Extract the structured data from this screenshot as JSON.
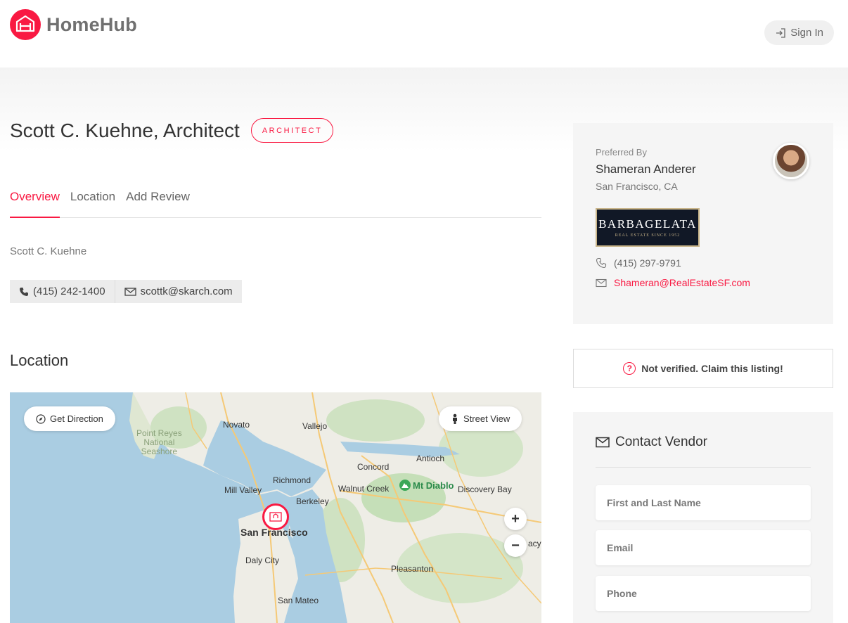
{
  "header": {
    "brand": "HomeHub",
    "sign_in": "Sign In"
  },
  "listing": {
    "title": "Scott C. Kuehne, Architect",
    "category_tag": "ARCHITECT",
    "tabs": [
      "Overview",
      "Location",
      "Add Review"
    ],
    "active_tab": "Overview",
    "owner": "Scott C. Kuehne",
    "phone": "(415) 242-1400",
    "email": "scottk@skarch.com"
  },
  "location": {
    "heading": "Location",
    "get_direction": "Get Direction",
    "street_view": "Street View",
    "zoom_in": "+",
    "zoom_out": "−",
    "places": {
      "novato": "Novato",
      "vallejo": "Vallejo",
      "point_reyes": "Point Reyes\nNational\nSeashore",
      "antioch": "Antioch",
      "concord": "Concord",
      "richmond": "Richmond",
      "walnut_creek": "Walnut Creek",
      "mt_diablo": "Mt Diablo",
      "discovery_bay": "Discovery Bay",
      "mill_valley": "Mill Valley",
      "berkeley": "Berkeley",
      "san_francisco": "San Francisco",
      "tracy_fragment": "acy",
      "daly_city": "Daly City",
      "pleasanton": "Pleasanton",
      "san_mateo": "San Mateo"
    }
  },
  "preferred": {
    "label": "Preferred By",
    "name": "Shameran Anderer",
    "city": "San Francisco, CA",
    "brokerage_name": "BARBAGELATA",
    "brokerage_tagline": "REAL ESTATE SINCE 1952",
    "phone": "(415) 297-9791",
    "email": "Shameran@RealEstateSF.com"
  },
  "claim": {
    "text": "Not verified. Claim this listing!"
  },
  "contact_vendor": {
    "title": "Contact Vendor",
    "fields": {
      "name": "First and Last Name",
      "email": "Email",
      "phone": "Phone"
    }
  },
  "colors": {
    "accent": "#f91942"
  }
}
